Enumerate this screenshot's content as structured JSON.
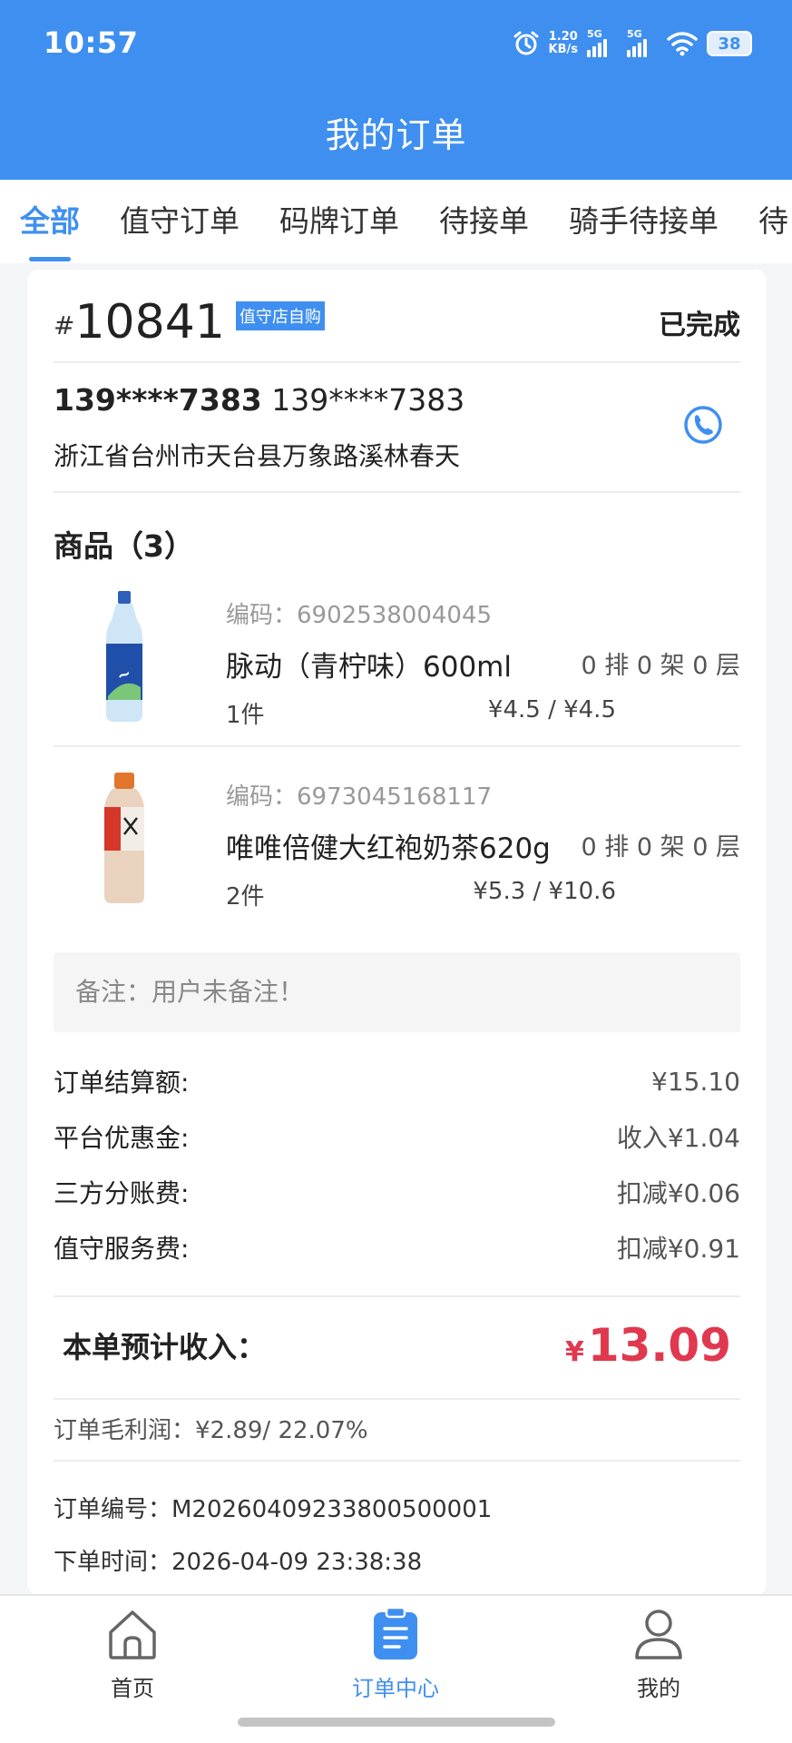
{
  "status_bar": {
    "time": "10:57",
    "net_speed_value": "1.20",
    "net_speed_unit": "KB/s",
    "signal_1": "5G",
    "signal_2": "5G",
    "battery": "38"
  },
  "header": {
    "title": "我的订单"
  },
  "tabs": [
    {
      "label": "全部",
      "active": true
    },
    {
      "label": "值守订单"
    },
    {
      "label": "码牌订单"
    },
    {
      "label": "待接单"
    },
    {
      "label": "骑手待接单"
    },
    {
      "label": "待"
    }
  ],
  "order": {
    "hash": "#",
    "number": "10841",
    "tag": "值守店自购",
    "status": "已完成",
    "phone_bold": "139****7383",
    "phone": "139****7383",
    "address": "浙江省台州市天台县万象路溪林春天",
    "goods_title": "商品（3）",
    "goods": [
      {
        "code": "编码：6902538004045",
        "name": "脉动（青柠味）600ml",
        "shelf": "0 排 0 架 0 层",
        "qty": "1件",
        "price": "¥4.5 / ¥4.5",
        "image": "blue-sports-drink-bottle-icon"
      },
      {
        "code": "编码：6973045168117",
        "name": "唯唯倍健大红袍奶茶620g",
        "shelf": "0 排 0 架 0 层",
        "qty": "2件",
        "price": "¥5.3 / ¥10.6",
        "image": "milk-tea-bottle-icon"
      }
    ],
    "remark": "备注：用户未备注！",
    "fees": [
      {
        "label": "订单结算额:",
        "value": "¥15.10"
      },
      {
        "label": "平台优惠金:",
        "value": "收入¥1.04"
      },
      {
        "label": "三方分账费:",
        "value": "扣减¥0.06"
      },
      {
        "label": "值守服务费:",
        "value": "扣减¥0.91"
      }
    ],
    "income_label": "本单预计收入：",
    "income_currency": "¥",
    "income_value": "13.09",
    "profit": "订单毛利润：¥2.89/ 22.07%",
    "order_id": "订单编号：M20260409233800500001",
    "order_time": "下单时间：2026-04-09 23:38:38"
  },
  "bottom_nav": [
    {
      "label": "首页",
      "icon": "home-icon"
    },
    {
      "label": "订单中心",
      "icon": "order-clipboard-icon",
      "active": true
    },
    {
      "label": "我的",
      "icon": "user-icon"
    }
  ],
  "colors": {
    "primary": "#3f8ff0",
    "income": "#e0384f"
  }
}
